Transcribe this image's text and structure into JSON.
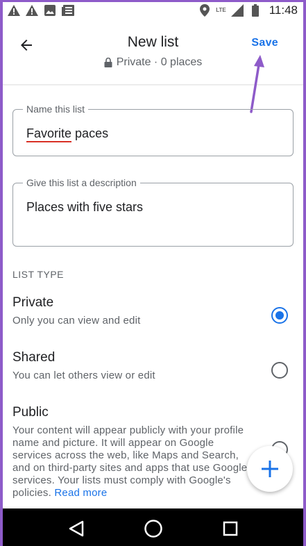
{
  "status_bar": {
    "time": "11:48",
    "network": "LTE",
    "icons": [
      "warning-icon",
      "warning-icon",
      "image-icon",
      "news-icon",
      "location-icon",
      "signal-icon",
      "battery-icon"
    ]
  },
  "header": {
    "title": "New list",
    "subtitle": "Private · 0 places",
    "save_label": "Save",
    "back_icon": "arrow-back-icon",
    "lock_icon": "lock-icon"
  },
  "form": {
    "name_field": {
      "label": "Name this list",
      "value": "Favorite paces"
    },
    "description_field": {
      "label": "Give this list a description",
      "value": "Places with five stars"
    }
  },
  "list_type": {
    "section_label": "LIST TYPE",
    "options": [
      {
        "title": "Private",
        "description": "Only you can view and edit",
        "selected": true
      },
      {
        "title": "Shared",
        "description": "You can let others view or edit",
        "selected": false
      },
      {
        "title": "Public",
        "description": "Your content will appear publicly with your profile name and picture. It will appear on Google services across the web, like Maps and Search, and on third-party sites and apps that use Google services. Your lists must comply with Google's policies.",
        "read_more": "Read more",
        "selected": false
      }
    ]
  },
  "fab": {
    "icon": "plus-icon"
  },
  "nav_bar": {
    "icons": [
      "back-triangle-icon",
      "home-circle-icon",
      "recents-square-icon"
    ]
  },
  "colors": {
    "accent": "#1a73e8",
    "annotation": "#8e5bc9",
    "spell_error": "#d93025"
  }
}
